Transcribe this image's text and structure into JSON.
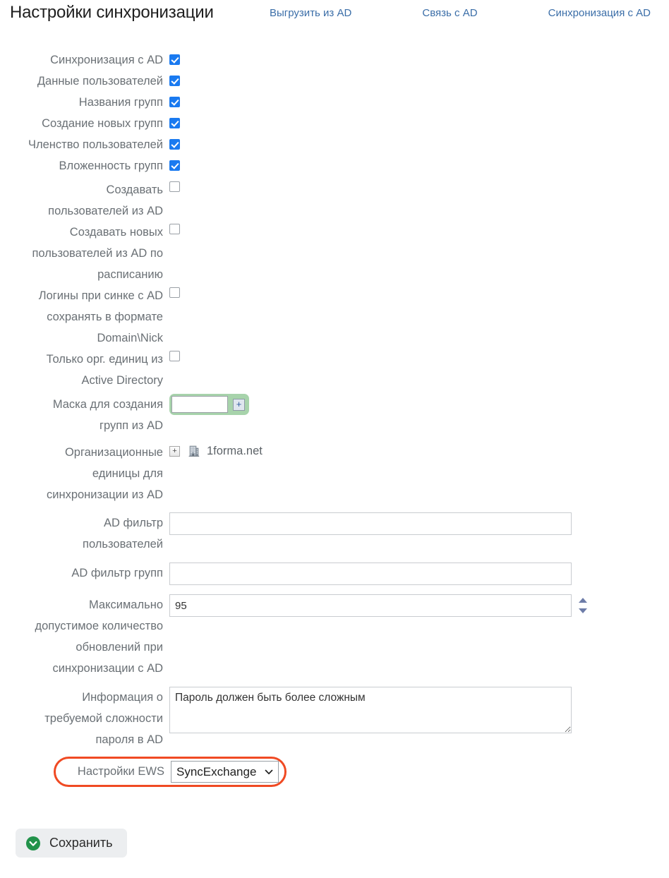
{
  "header": {
    "title": "Настройки синхронизации",
    "nav": [
      {
        "label": "Выгрузить из AD",
        "name": "nav-export-from-ad"
      },
      {
        "label": "Связь с AD",
        "name": "nav-ad-connection"
      },
      {
        "label": "Синхронизация с AD",
        "name": "nav-ad-sync"
      }
    ]
  },
  "form": {
    "checkboxes": [
      {
        "label": "Синхронизация с AD",
        "checked": true
      },
      {
        "label": "Данные пользователей",
        "checked": true
      },
      {
        "label": "Названия групп",
        "checked": true
      },
      {
        "label": "Создание новых групп",
        "checked": true
      },
      {
        "label": "Членство пользователей",
        "checked": true
      },
      {
        "label": "Вложенность групп",
        "checked": true
      },
      {
        "label": "Создавать\nпользователей из AD",
        "checked": false
      },
      {
        "label": "Создавать новых\nпользователей из AD по\nрасписанию",
        "checked": false
      },
      {
        "label": "Логины при синке с AD\nсохранять в формате\nDomain\\Nick",
        "checked": false
      },
      {
        "label": "Только орг. единиц из\nActive Directory",
        "checked": false
      }
    ],
    "mask": {
      "label": "Маска для создания\nгрупп из AD",
      "value": "",
      "add_button": "+"
    },
    "org_units": {
      "label": "Организационные\nединицы для\nсинхронизации из AD",
      "expand": "+",
      "node": "1forma.net",
      "node_icon": "building-icon"
    },
    "ad_user_filter": {
      "label": "AD фильтр\nпользователей",
      "value": ""
    },
    "ad_group_filter": {
      "label": "AD фильтр групп",
      "value": ""
    },
    "max_updates": {
      "label": "Максимально\nдопустимое количество\nобновлений при\nсинхронизации с AD",
      "value": "95"
    },
    "password_info": {
      "label": "Информация о\nтребуемой сложности\nпароля в AD",
      "value": "Пароль должен быть более сложным"
    },
    "ews": {
      "label": "Настройки EWS",
      "selected": "SyncExchange",
      "options": [
        "SyncExchange"
      ],
      "highlight_color": "#f04a23"
    }
  },
  "footer": {
    "save_label": "Сохранить",
    "save_icon": "chevron-down-circle-icon",
    "save_icon_color": "#21924a"
  }
}
